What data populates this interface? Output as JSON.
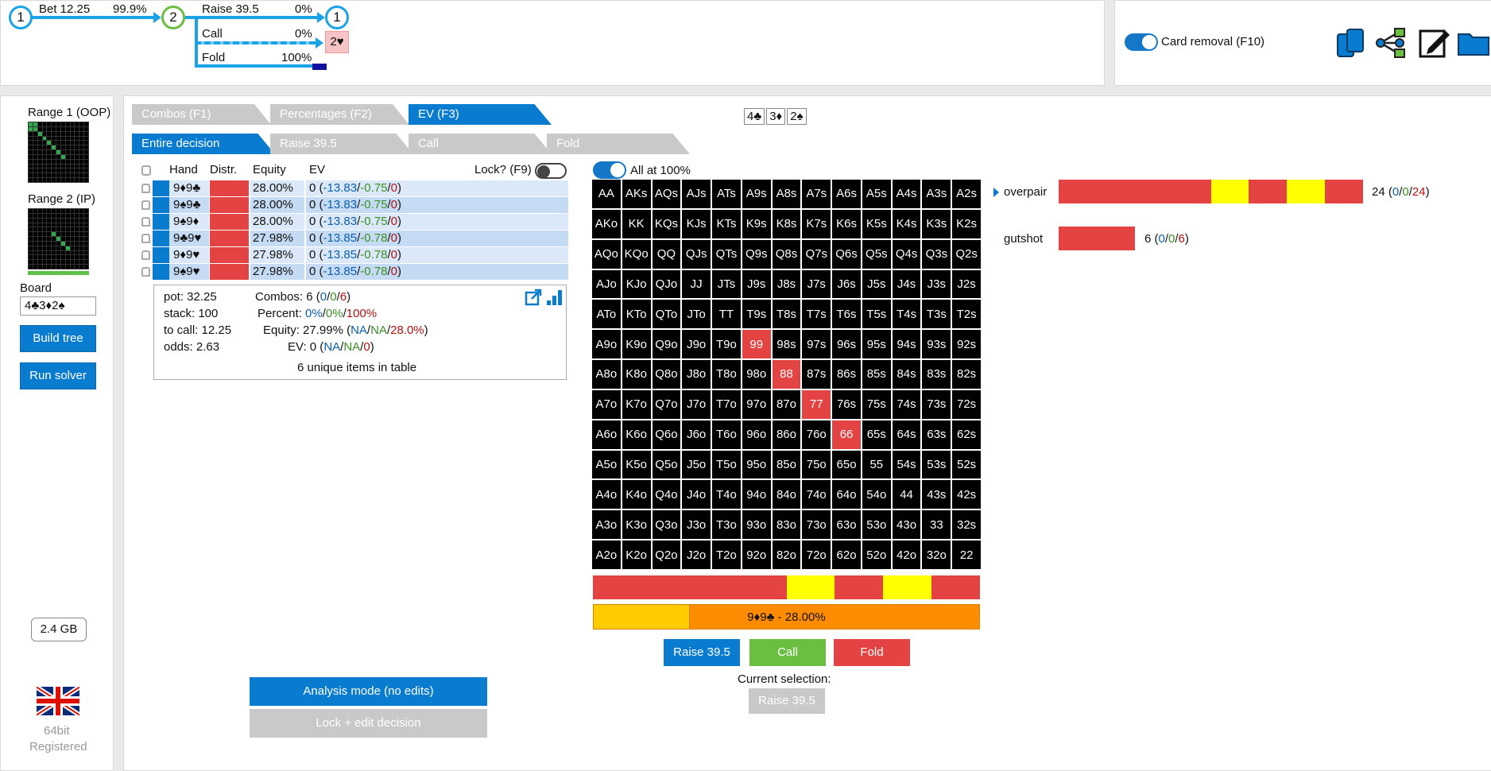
{
  "tree": {
    "node1_label": "1",
    "node2_label": "2",
    "node3_label": "1",
    "bet_label": "Bet 12.25",
    "bet_pct": "99.9%",
    "raise_label": "Raise 39.5",
    "raise_pct": "0%",
    "call_label": "Call",
    "call_pct": "0%",
    "fold_label": "Fold",
    "fold_pct": "100%",
    "call_end_label": "2♥"
  },
  "top_right": {
    "card_removal_label": "Card removal (F10)"
  },
  "left": {
    "range1_label": "Range 1 (OOP)",
    "range2_label": "Range 2 (IP)",
    "board_label": "Board",
    "board_value": "4♣3♦2♠",
    "build_tree": "Build tree",
    "run_solver": "Run solver",
    "memory": "2.4 GB",
    "bitness": "64bit",
    "registered": "Registered"
  },
  "tabs": {
    "combos": "Combos (F1)",
    "percentages": "Percentages (F2)",
    "ev": "EV (F3)",
    "entire_decision": "Entire decision",
    "raise": "Raise 39.5",
    "call": "Call",
    "fold": "Fold"
  },
  "board_cards": [
    "4♣",
    "3♦",
    "2♠"
  ],
  "hand_table": {
    "headers": {
      "hand": "Hand",
      "distr": "Distr.",
      "equity": "Equity",
      "ev": "EV",
      "lock": "Lock? (F9)"
    },
    "rows": [
      {
        "hand": "9♦9♣",
        "equity": "28.00%",
        "ev0": "0 (",
        "ev1": "-13.83",
        "ev2": "-0.75",
        "ev3": "0",
        "bg": "#dbe8f7"
      },
      {
        "hand": "9♠9♣",
        "equity": "28.00%",
        "ev0": "0 (",
        "ev1": "-13.83",
        "ev2": "-0.75",
        "ev3": "0",
        "bg": "#c5daf3"
      },
      {
        "hand": "9♠9♦",
        "equity": "28.00%",
        "ev0": "0 (",
        "ev1": "-13.83",
        "ev2": "-0.75",
        "ev3": "0",
        "bg": "#dbe8f7"
      },
      {
        "hand": "9♣9♥",
        "equity": "27.98%",
        "ev0": "0 (",
        "ev1": "-13.85",
        "ev2": "-0.78",
        "ev3": "0",
        "bg": "#c5daf3"
      },
      {
        "hand": "9♦9♥",
        "equity": "27.98%",
        "ev0": "0 (",
        "ev1": "-13.85",
        "ev2": "-0.78",
        "ev3": "0",
        "bg": "#dbe8f7"
      },
      {
        "hand": "9♠9♥",
        "equity": "27.98%",
        "ev0": "0 (",
        "ev1": "-13.85",
        "ev2": "-0.78",
        "ev3": "0",
        "bg": "#c5daf3"
      }
    ]
  },
  "info": {
    "pot": "pot: 32.25",
    "stack": "stack: 100",
    "to_call": "to call: 12.25",
    "odds": "odds: 2.63",
    "combos_label": "Combos:",
    "combos_a": "6 (",
    "combos_b": "0",
    "combos_c": "0",
    "combos_d": "6",
    "percent_label": "Percent:",
    "percent_b": "0%",
    "percent_c": "0%",
    "percent_d": "100%",
    "equity_label": "Equity:",
    "equity_a": "27.99% (",
    "equity_b": "NA",
    "equity_c": "NA",
    "equity_d": "28.0%",
    "ev_label": "EV:",
    "ev_a": "0 (",
    "ev_b": "NA",
    "ev_c": "NA",
    "ev_d": "0",
    "unique": "6 unique items in table"
  },
  "grid": {
    "all_at_label": "All at 100%",
    "cells": [
      "AA",
      "AKs",
      "AQs",
      "AJs",
      "ATs",
      "A9s",
      "A8s",
      "A7s",
      "A6s",
      "A5s",
      "A4s",
      "A3s",
      "A2s",
      "AKo",
      "KK",
      "KQs",
      "KJs",
      "KTs",
      "K9s",
      "K8s",
      "K7s",
      "K6s",
      "K5s",
      "K4s",
      "K3s",
      "K2s",
      "AQo",
      "KQo",
      "QQ",
      "QJs",
      "QTs",
      "Q9s",
      "Q8s",
      "Q7s",
      "Q6s",
      "Q5s",
      "Q4s",
      "Q3s",
      "Q2s",
      "AJo",
      "KJo",
      "QJo",
      "JJ",
      "JTs",
      "J9s",
      "J8s",
      "J7s",
      "J6s",
      "J5s",
      "J4s",
      "J3s",
      "J2s",
      "ATo",
      "KTo",
      "QTo",
      "JTo",
      "TT",
      "T9s",
      "T8s",
      "T7s",
      "T6s",
      "T5s",
      "T4s",
      "T3s",
      "T2s",
      "A9o",
      "K9o",
      "Q9o",
      "J9o",
      "T9o",
      "99",
      "98s",
      "97s",
      "96s",
      "95s",
      "94s",
      "93s",
      "92s",
      "A8o",
      "K8o",
      "Q8o",
      "J8o",
      "T8o",
      "98o",
      "88",
      "87s",
      "86s",
      "85s",
      "84s",
      "83s",
      "82s",
      "A7o",
      "K7o",
      "Q7o",
      "J7o",
      "T7o",
      "97o",
      "87o",
      "77",
      "76s",
      "75s",
      "74s",
      "73s",
      "72s",
      "A6o",
      "K6o",
      "Q6o",
      "J6o",
      "T6o",
      "96o",
      "86o",
      "76o",
      "66",
      "65s",
      "64s",
      "63s",
      "62s",
      "A5o",
      "K5o",
      "Q5o",
      "J5o",
      "T5o",
      "95o",
      "85o",
      "75o",
      "65o",
      "55",
      "54s",
      "53s",
      "52s",
      "A4o",
      "K4o",
      "Q4o",
      "J4o",
      "T4o",
      "94o",
      "84o",
      "74o",
      "64o",
      "54o",
      "44",
      "43s",
      "42s",
      "A3o",
      "K3o",
      "Q3o",
      "J3o",
      "T3o",
      "93o",
      "83o",
      "73o",
      "63o",
      "53o",
      "43o",
      "33",
      "32s",
      "A2o",
      "K2o",
      "Q2o",
      "J2o",
      "T2o",
      "92o",
      "82o",
      "72o",
      "62o",
      "52o",
      "42o",
      "32o",
      "22"
    ],
    "highlighted": [
      "99",
      "88",
      "77",
      "66"
    ]
  },
  "bars": {
    "hand_bar_label": "9♦9♣ - 28.00%"
  },
  "categories": [
    {
      "name": "overpair",
      "count_a": "24 (",
      "count_b": "0",
      "count_c": "0",
      "count_d": "24"
    },
    {
      "name": "gutshot",
      "count_a": "6 (",
      "count_b": "0",
      "count_c": "0",
      "count_d": "6"
    }
  ],
  "actions": {
    "raise": "Raise 39.5",
    "call": "Call",
    "fold": "Fold",
    "current_selection_label": "Current selection:",
    "current_selection_value": "Raise 39.5",
    "analysis_mode": "Analysis mode (no edits)",
    "lock_edit": "Lock + edit decision"
  },
  "colors": {
    "accent_blue": "#0a7ccf",
    "call_green": "#6abf40",
    "fold_red": "#e34343",
    "mixed_yellow": "#ffff00",
    "equity_orange": "#ff8c00"
  }
}
